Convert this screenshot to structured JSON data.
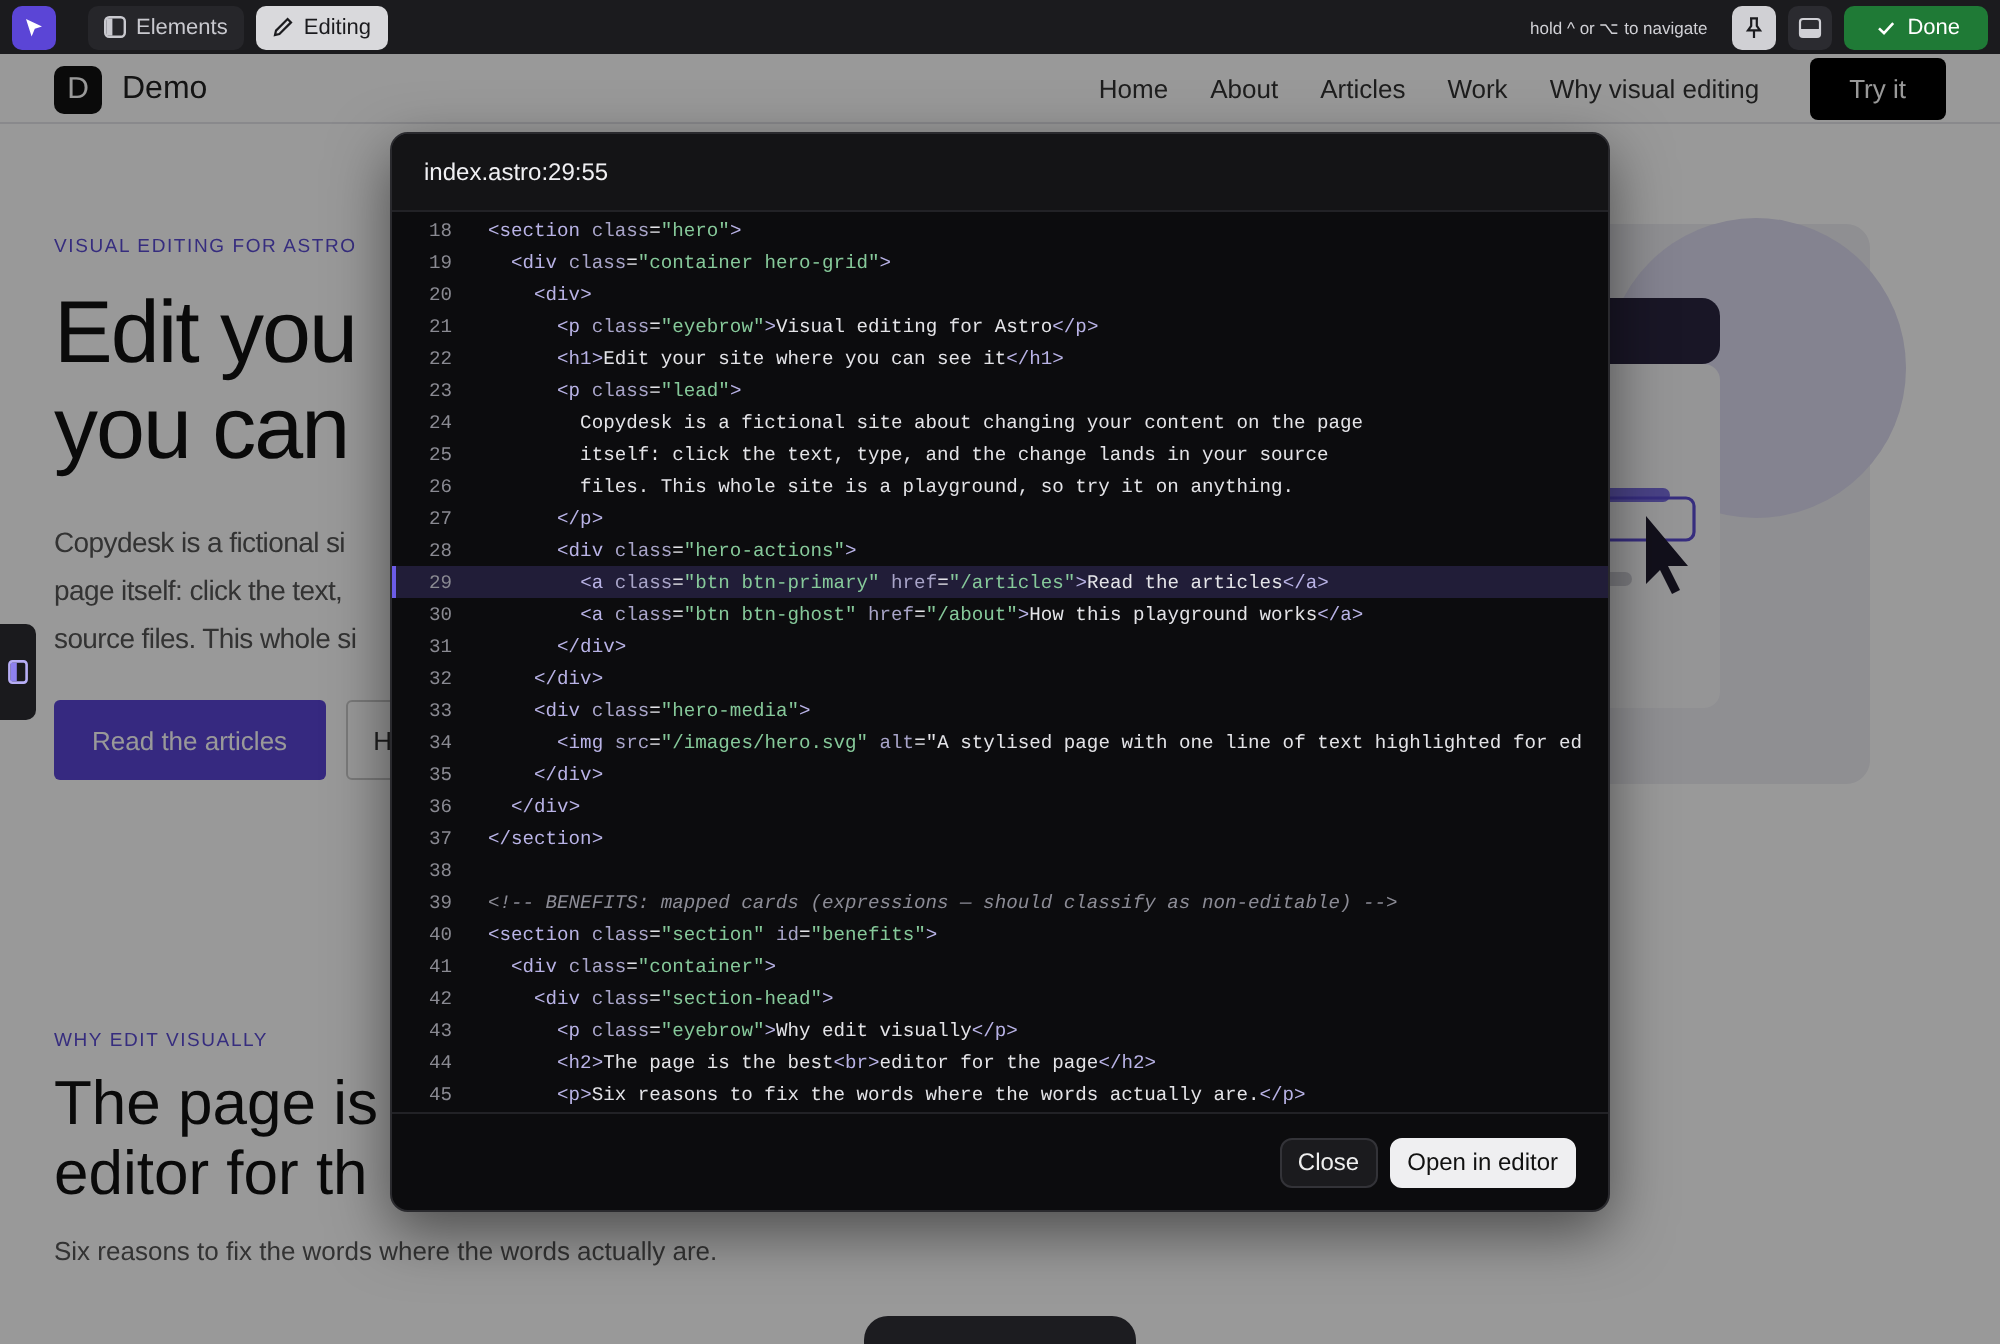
{
  "toolbar": {
    "tabs": [
      {
        "label": "Elements",
        "selected": false
      },
      {
        "label": "Editing",
        "selected": true
      }
    ],
    "hint": "hold ^ or ⌥ to navigate",
    "pinned": true,
    "done": "Done"
  },
  "site": {
    "logo_letter": "D",
    "brand": "Demo",
    "nav": [
      "Home",
      "About",
      "Articles",
      "Work",
      "Why visual editing"
    ],
    "cta": "Try it",
    "hero": {
      "eyebrow": "VISUAL EDITING FOR ASTRO",
      "heading": [
        "Edit you",
        "you can"
      ],
      "lead": [
        "Copydesk is a fictional si",
        "page itself: click the text,",
        "source files. This whole si"
      ],
      "buttons": [
        {
          "label": "Read the articles",
          "kind": "primary"
        },
        {
          "label": "H",
          "kind": "ghost"
        }
      ]
    },
    "benefits": {
      "eyebrow": "WHY EDIT VISUALLY",
      "heading": [
        "The page is",
        "editor for th"
      ],
      "text": "Six reasons to fix the words where the words actually are."
    }
  },
  "dialog": {
    "title": "index.astro:29:55",
    "lines": [
      {
        "num": "18",
        "code": "<section class=\"hero\">",
        "highlighted": false
      },
      {
        "num": "19",
        "code": "  <div class=\"container hero-grid\">",
        "highlighted": false
      },
      {
        "num": "20",
        "code": "    <div>",
        "highlighted": false
      },
      {
        "num": "21",
        "code": "      <p class=\"eyebrow\">Visual editing for Astro</p>",
        "highlighted": false
      },
      {
        "num": "22",
        "code": "      <h1>Edit your site where you can see it</h1>",
        "highlighted": false
      },
      {
        "num": "23",
        "code": "      <p class=\"lead\">",
        "highlighted": false
      },
      {
        "num": "24",
        "code": "        Copydesk is a fictional site about changing your content on the page",
        "highlighted": false
      },
      {
        "num": "25",
        "code": "        itself: click the text, type, and the change lands in your source",
        "highlighted": false
      },
      {
        "num": "26",
        "code": "        files. This whole site is a playground, so try it on anything.",
        "highlighted": false
      },
      {
        "num": "27",
        "code": "      </p>",
        "highlighted": false
      },
      {
        "num": "28",
        "code": "      <div class=\"hero-actions\">",
        "highlighted": false
      },
      {
        "num": "29",
        "code": "        <a class=\"btn btn-primary\" href=\"/articles\">Read the articles</a>",
        "highlighted": true
      },
      {
        "num": "30",
        "code": "        <a class=\"btn btn-ghost\" href=\"/about\">How this playground works</a>",
        "highlighted": false
      },
      {
        "num": "31",
        "code": "      </div>",
        "highlighted": false
      },
      {
        "num": "32",
        "code": "    </div>",
        "highlighted": false
      },
      {
        "num": "33",
        "code": "    <div class=\"hero-media\">",
        "highlighted": false
      },
      {
        "num": "34",
        "code": "      <img src=\"/images/hero.svg\" alt=\"A stylised page with one line of text highlighted for ed",
        "highlighted": false
      },
      {
        "num": "35",
        "code": "    </div>",
        "highlighted": false
      },
      {
        "num": "36",
        "code": "  </div>",
        "highlighted": false
      },
      {
        "num": "37",
        "code": "</section>",
        "highlighted": false
      },
      {
        "num": "38",
        "highlighted": false
      },
      {
        "num": "39",
        "code": "<!-- BENEFITS: mapped cards (expressions — should classify as non-editable) -->",
        "highlighted": false
      },
      {
        "num": "40",
        "code": "<section class=\"section\" id=\"benefits\">",
        "highlighted": false
      },
      {
        "num": "41",
        "code": "  <div class=\"container\">",
        "highlighted": false
      },
      {
        "num": "42",
        "code": "    <div class=\"section-head\">",
        "highlighted": false
      },
      {
        "num": "43",
        "code": "      <p class=\"eyebrow\">Why edit visually</p>",
        "highlighted": false
      },
      {
        "num": "44",
        "code": "      <h2>The page is the best<br>editor for the page</h2>",
        "highlighted": false
      },
      {
        "num": "45",
        "code": "      <p>Six reasons to fix the words where the words actually are.</p>",
        "highlighted": false
      }
    ],
    "buttons": [
      {
        "label": "Close",
        "kind": "secondary"
      },
      {
        "label": "Open in editor",
        "kind": "primary"
      }
    ]
  }
}
